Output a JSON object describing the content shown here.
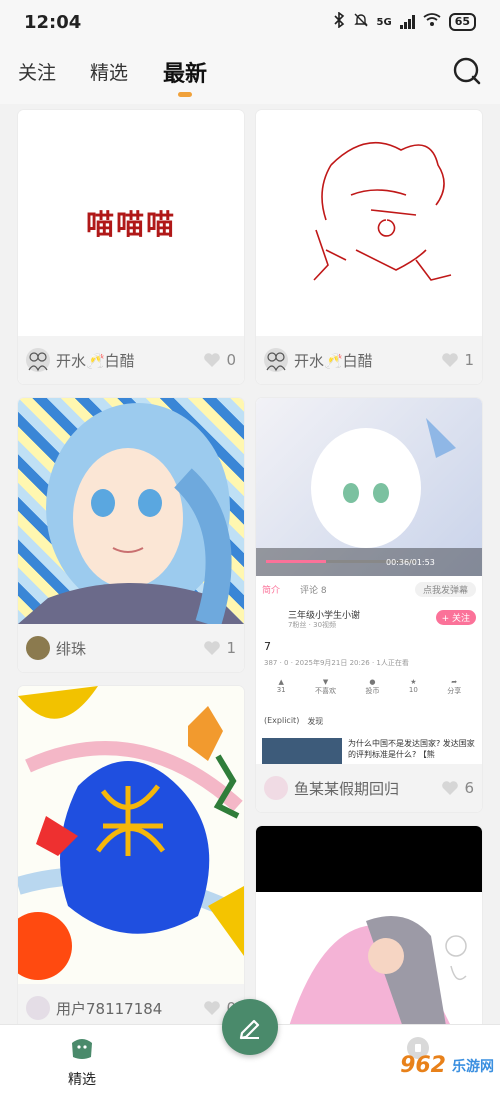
{
  "status_bar": {
    "time": "12:04",
    "network": "5G",
    "battery": "65"
  },
  "nav": {
    "tabs": [
      {
        "label": "关注"
      },
      {
        "label": "精选"
      },
      {
        "label": "最新"
      }
    ],
    "active_tab": "最新"
  },
  "feed": {
    "left": [
      {
        "title_text": "喵喵喵",
        "author": "开水🥂白醋",
        "likes": "0"
      },
      {
        "author": "绯珠",
        "likes": "1"
      },
      {
        "author": "用户78117184",
        "likes": "0"
      }
    ],
    "right": [
      {
        "author": "开水🥂白醋",
        "likes": "1"
      },
      {
        "author": "鱼某某假期回归",
        "likes": "6",
        "video": {
          "time": "00:36/01:53",
          "tabs": [
            "简介",
            "评论 8"
          ],
          "danmaku_placeholder": "点我发弹幕",
          "uploader": "三年级小学生小谢",
          "uploader_stats": "7粉丝 · 30视频",
          "follow_label": "+ 关注",
          "video_title": "7",
          "stats": "387 · 0 · 2025年9月21日 20:26 · 1人正在看",
          "actions": [
            "31",
            "不喜欢",
            "投币",
            "10",
            "分享"
          ],
          "tag_1": "(Explicit)",
          "tag_2": "发现",
          "rec_title": "为什么中国不是发达国家? 发达国家的评判标准是什么? 【熊"
        }
      },
      {
        "author": "",
        "likes": ""
      }
    ]
  },
  "bottom_nav": {
    "left_label": "精选",
    "right_label": "",
    "watermark_logo": "962",
    "watermark_text": "乐游网"
  }
}
